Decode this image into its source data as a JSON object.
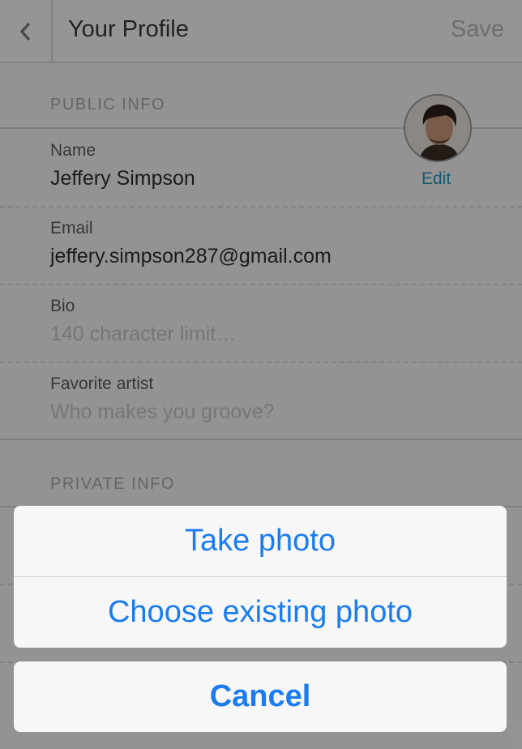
{
  "header": {
    "title": "Your Profile",
    "save_label": "Save",
    "back_icon": "chevron-left-icon"
  },
  "public_info": {
    "section_label": "PUBLIC INFO",
    "avatar_edit_label": "Edit",
    "fields": [
      {
        "label": "Name",
        "value": "Jeffery Simpson",
        "placeholder": ""
      },
      {
        "label": "Email",
        "value": "jeffery.simpson287@gmail.com",
        "placeholder": ""
      },
      {
        "label": "Bio",
        "value": "",
        "placeholder": "140 character limit…"
      },
      {
        "label": "Favorite artist",
        "value": "",
        "placeholder": "Who makes you groove?"
      }
    ]
  },
  "private_info": {
    "section_label": "PRIVATE INFO"
  },
  "action_sheet": {
    "take_photo": "Take photo",
    "choose_existing": "Choose existing photo",
    "cancel": "Cancel"
  },
  "colors": {
    "accent": "#1a7cf0",
    "edit_link": "#2a93b6",
    "overlay": "rgba(0,0,0,0.40)"
  }
}
